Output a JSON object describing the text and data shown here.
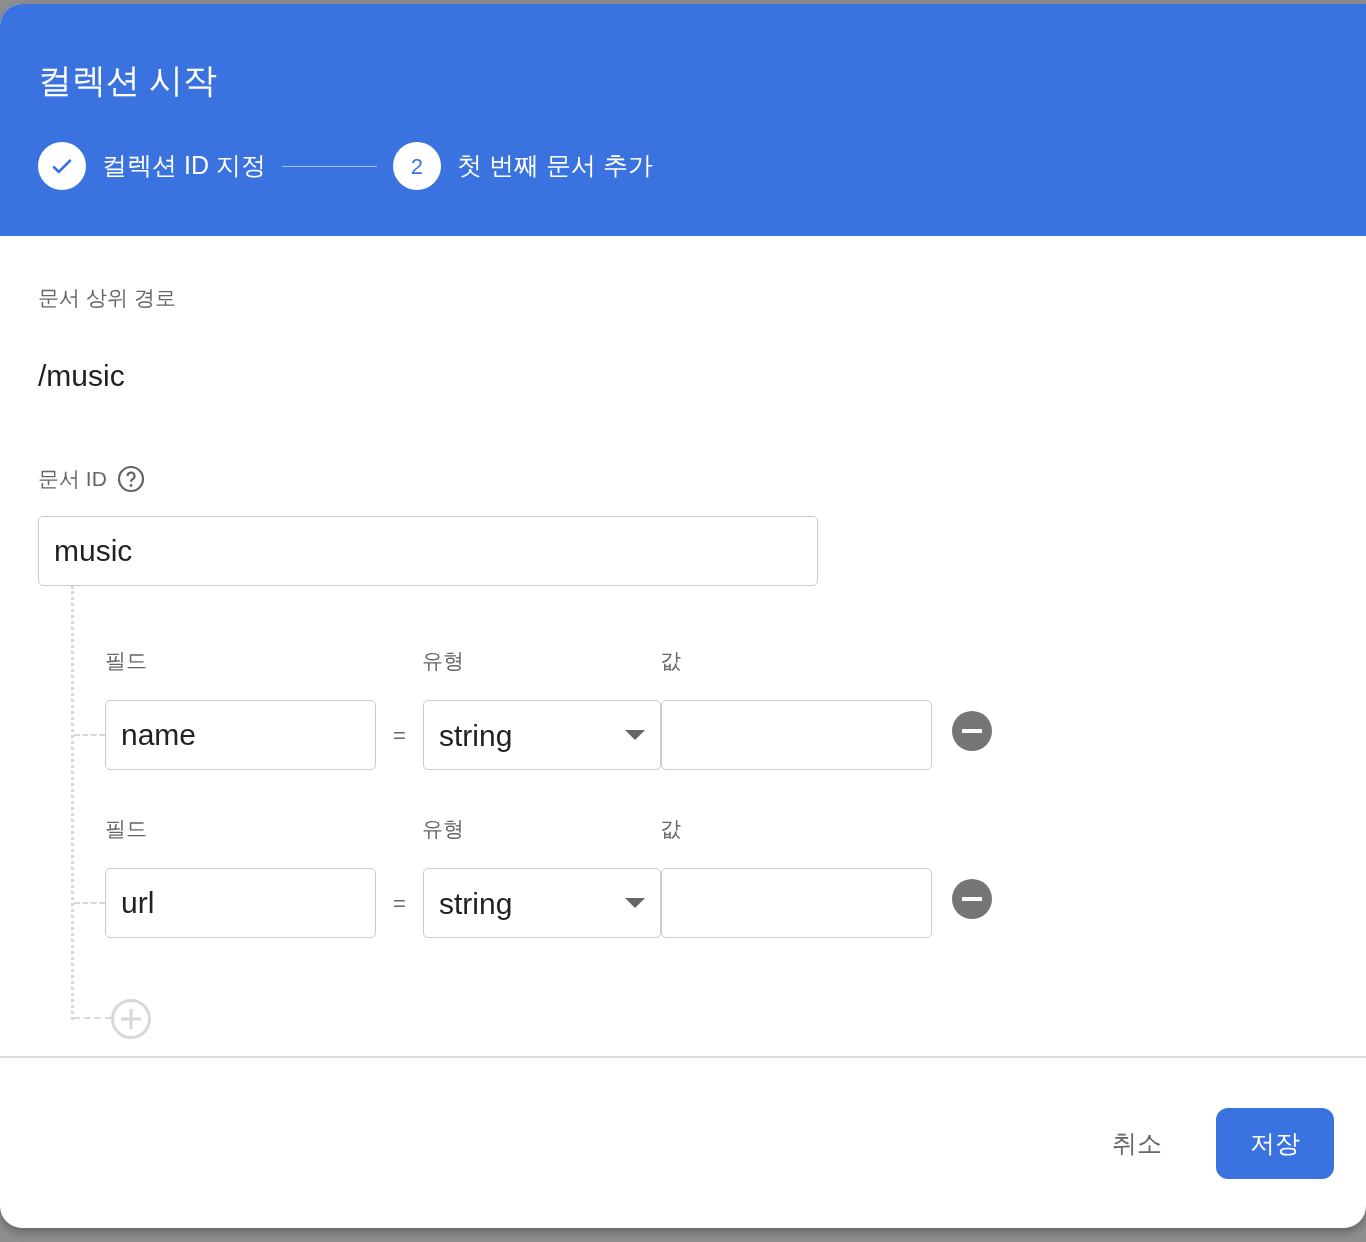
{
  "dialog": {
    "title": "컬렉션 시작",
    "steps": [
      {
        "label": "컬렉션 ID 지정",
        "completed": true
      },
      {
        "number": "2",
        "label": "첫 번째 문서 추가",
        "completed": false
      }
    ],
    "parent_path": {
      "label": "문서 상위 경로",
      "value": "/music"
    },
    "document_id": {
      "label": "문서 ID",
      "value": "music"
    },
    "fields": [
      {
        "field_label": "필드",
        "type_label": "유형",
        "value_label": "값",
        "name": "name",
        "equals": "=",
        "type": "string"
      },
      {
        "field_label": "필드",
        "type_label": "유형",
        "value_label": "값",
        "name": "url",
        "equals": "=",
        "type": "string"
      }
    ],
    "buttons": [
      {
        "label": "취소",
        "kind": "text"
      },
      {
        "label": "저장",
        "kind": "primary"
      }
    ]
  }
}
